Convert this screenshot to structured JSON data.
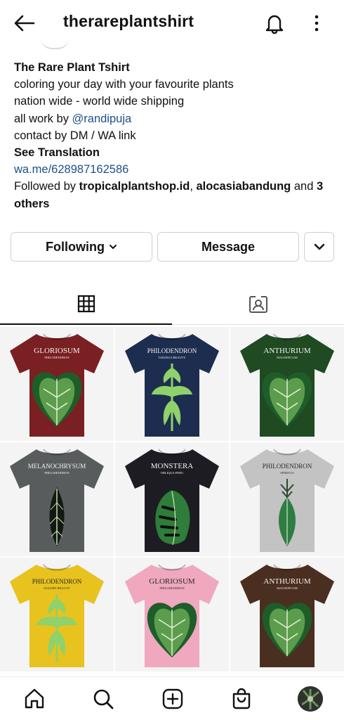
{
  "header": {
    "back_icon": "arrow-left-icon",
    "username": "therareplantshirt",
    "notification_icon": "bell-icon",
    "more_icon": "more-vertical-icon"
  },
  "bio": {
    "name": "The Rare Plant Tshirt",
    "line1": "coloring your day with your favourite plants",
    "line2": "nation wide - world wide shipping",
    "line3_prefix": "all work by ",
    "line3_mention": "@randipuja",
    "line4": "contact by DM / WA link",
    "translate": "See Translation",
    "link": "wa.me/628987162586",
    "followed_prefix": "Followed by ",
    "followed_user1": "tropicalplantshop.id",
    "followed_sep": ", ",
    "followed_user2": "alocasiabandung",
    "followed_and": " and ",
    "followed_others": "3 others"
  },
  "actions": {
    "following_label": "Following",
    "message_label": "Message",
    "suggest_icon": "chevron-down-icon"
  },
  "tabs": [
    {
      "icon": "grid-icon",
      "active": true
    },
    {
      "icon": "tagged-person-icon",
      "active": false
    }
  ],
  "posts": [
    {
      "title": "GLORIOSUM",
      "subtitle": "PHILODENDRON",
      "shirt": "#7a1f22",
      "leaf": "heart"
    },
    {
      "title": "PHILODENDRON",
      "subtitle": "TAKINGA BEAUTY",
      "shirt": "#1d2d4f",
      "leaf": "lobed"
    },
    {
      "title": "ANTHURIUM",
      "subtitle": "MAGNIFICUM",
      "shirt": "#1f4a22",
      "leaf": "heart"
    },
    {
      "title": "MELANOCHRYSUM",
      "subtitle": "PHILODENDRON",
      "shirt": "#595c5d",
      "leaf": "long"
    },
    {
      "title": "MONSTERA",
      "subtitle": "OBLIQUA PERU",
      "shirt": "#1c1c22",
      "leaf": "split"
    },
    {
      "title": "PHILODENDRON",
      "subtitle": "SPIRITUS",
      "shirt": "#c3c3c3",
      "leaf": "pendant"
    },
    {
      "title": "PHILODENDRON",
      "subtitle": "GOLDEN BEAUTY",
      "shirt": "#e8c21e",
      "leaf": "lobed"
    },
    {
      "title": "GLORIOSUM",
      "subtitle": "PHILODENDRON",
      "shirt": "#efa8be",
      "leaf": "heart"
    },
    {
      "title": "ANTHURIUM",
      "subtitle": "MAGNIFICUM",
      "shirt": "#4a2e1f",
      "leaf": "heart"
    }
  ],
  "bottom_nav": [
    {
      "icon": "home-icon"
    },
    {
      "icon": "search-icon"
    },
    {
      "icon": "add-post-icon"
    },
    {
      "icon": "shop-bag-icon"
    },
    {
      "icon": "profile-avatar"
    }
  ],
  "colors": {
    "link": "#1e4f8a",
    "border": "#cfcfcf",
    "leaf_light": "#8fd16a",
    "leaf_dark": "#1e5d2a"
  }
}
